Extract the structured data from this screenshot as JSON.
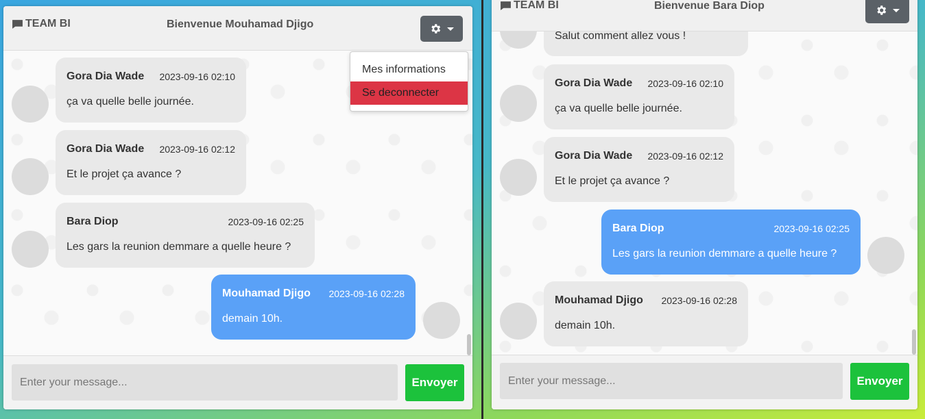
{
  "left_panel": {
    "brand": "TEAM BI",
    "welcome": "Bienvenue Mouhamad Djigo",
    "settings_menu": {
      "items": [
        "Mes informations",
        "Se deconnecter"
      ]
    },
    "messages": [
      {
        "sender": "Gora Dia Wade",
        "time": "2023-09-16 02:10",
        "text": "ça va quelle belle journée.",
        "mine": false
      },
      {
        "sender": "Gora Dia Wade",
        "time": "2023-09-16 02:12",
        "text": "Et le projet ça avance ?",
        "mine": false
      },
      {
        "sender": "Bara Diop",
        "time": "2023-09-16 02:25",
        "text": "Les gars la reunion demmare a quelle heure ?",
        "mine": false
      },
      {
        "sender": "Mouhamad Djigo",
        "time": "2023-09-16 02:28",
        "text": "demain 10h.",
        "mine": true
      }
    ],
    "input_placeholder": "Enter your message...",
    "send_label": "Envoyer"
  },
  "right_panel": {
    "brand": "TEAM BI",
    "welcome": "Bienvenue Bara Diop",
    "messages": [
      {
        "sender": "",
        "time": "",
        "text": "Salut comment allez vous !",
        "mine": false
      },
      {
        "sender": "Gora Dia Wade",
        "time": "2023-09-16 02:10",
        "text": "ça va quelle belle journée.",
        "mine": false
      },
      {
        "sender": "Gora Dia Wade",
        "time": "2023-09-16 02:12",
        "text": "Et le projet ça avance ?",
        "mine": false
      },
      {
        "sender": "Bara Diop",
        "time": "2023-09-16 02:25",
        "text": "Les gars la reunion demmare a quelle heure ?",
        "mine": true
      },
      {
        "sender": "Mouhamad Djigo",
        "time": "2023-09-16 02:28",
        "text": "demain 10h.",
        "mine": false
      }
    ],
    "input_placeholder": "Enter your message...",
    "send_label": "Envoyer"
  },
  "colors": {
    "own_bubble": "#5aa1f7",
    "other_bubble": "#e9e9e9",
    "send_button": "#1cc23c",
    "logout_item": "#dc3545",
    "settings_button": "#5b6167"
  },
  "icons": {
    "brand": "chat-bubble-icon",
    "settings": "gear-icon",
    "settings_caret": "caret-down-icon"
  }
}
